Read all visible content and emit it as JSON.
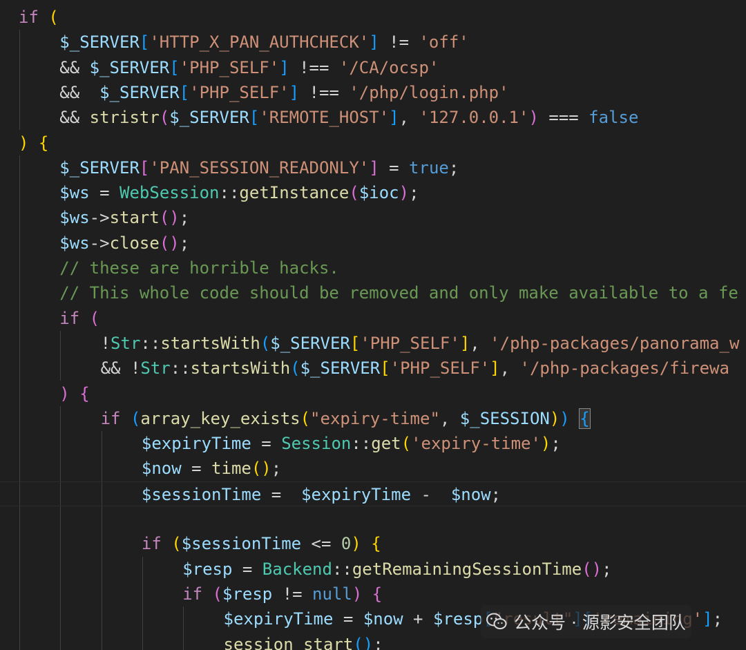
{
  "editor": {
    "colors": {
      "background": "#1f1f1f",
      "keyword": "#c586c0",
      "variable": "#9cdcfe",
      "string": "#ce9178",
      "function": "#dcdcaa",
      "class": "#4ec9b0",
      "comment": "#6a9955",
      "literal": "#569cd6",
      "number": "#b5cea8",
      "bracket_level1": "#ffd700",
      "bracket_level2": "#da70d6",
      "bracket_level3": "#179fff"
    },
    "current_line": 19,
    "lines": [
      {
        "indent": 0,
        "tokens": [
          {
            "t": "if ",
            "c": "kw"
          },
          {
            "t": "(",
            "c": "b1"
          }
        ]
      },
      {
        "indent": 1,
        "tokens": [
          {
            "t": "$_SERVER",
            "c": "var"
          },
          {
            "t": "[",
            "c": "b3"
          },
          {
            "t": "'HTTP_X_PAN_AUTHCHECK'",
            "c": "str"
          },
          {
            "t": "]",
            "c": "b3"
          },
          {
            "t": " != ",
            "c": "op"
          },
          {
            "t": "'off'",
            "c": "str"
          }
        ]
      },
      {
        "indent": 1,
        "tokens": [
          {
            "t": "&& ",
            "c": "op"
          },
          {
            "t": "$_SERVER",
            "c": "var"
          },
          {
            "t": "[",
            "c": "b3"
          },
          {
            "t": "'PHP_SELF'",
            "c": "str"
          },
          {
            "t": "]",
            "c": "b3"
          },
          {
            "t": " !== ",
            "c": "op"
          },
          {
            "t": "'/CA/ocsp'",
            "c": "str"
          }
        ]
      },
      {
        "indent": 1,
        "tokens": [
          {
            "t": "&&  ",
            "c": "op"
          },
          {
            "t": "$_SERVER",
            "c": "var"
          },
          {
            "t": "[",
            "c": "b3"
          },
          {
            "t": "'PHP_SELF'",
            "c": "str"
          },
          {
            "t": "]",
            "c": "b3"
          },
          {
            "t": " !== ",
            "c": "op"
          },
          {
            "t": "'/php/login.php'",
            "c": "str"
          }
        ]
      },
      {
        "indent": 1,
        "tokens": [
          {
            "t": "&& ",
            "c": "op"
          },
          {
            "t": "stristr",
            "c": "fn"
          },
          {
            "t": "(",
            "c": "b2"
          },
          {
            "t": "$_SERVER",
            "c": "var"
          },
          {
            "t": "[",
            "c": "b3"
          },
          {
            "t": "'REMOTE_HOST'",
            "c": "str"
          },
          {
            "t": "]",
            "c": "b3"
          },
          {
            "t": ", ",
            "c": "op"
          },
          {
            "t": "'127.0.0.1'",
            "c": "str"
          },
          {
            "t": ")",
            "c": "b2"
          },
          {
            "t": " === ",
            "c": "op"
          },
          {
            "t": "false",
            "c": "lit"
          }
        ]
      },
      {
        "indent": 0,
        "tokens": [
          {
            "t": ")",
            "c": "b1"
          },
          {
            "t": " ",
            "c": "op"
          },
          {
            "t": "{",
            "c": "b1"
          }
        ]
      },
      {
        "indent": 1,
        "tokens": [
          {
            "t": "$_SERVER",
            "c": "var"
          },
          {
            "t": "[",
            "c": "b2"
          },
          {
            "t": "'PAN_SESSION_READONLY'",
            "c": "str"
          },
          {
            "t": "]",
            "c": "b2"
          },
          {
            "t": " = ",
            "c": "op"
          },
          {
            "t": "true",
            "c": "lit"
          },
          {
            "t": ";",
            "c": "op"
          }
        ]
      },
      {
        "indent": 1,
        "tokens": [
          {
            "t": "$ws",
            "c": "var"
          },
          {
            "t": " = ",
            "c": "op"
          },
          {
            "t": "WebSession",
            "c": "cls"
          },
          {
            "t": "::",
            "c": "op"
          },
          {
            "t": "getInstance",
            "c": "fn"
          },
          {
            "t": "(",
            "c": "b2"
          },
          {
            "t": "$ioc",
            "c": "var"
          },
          {
            "t": ")",
            "c": "b2"
          },
          {
            "t": ";",
            "c": "op"
          }
        ]
      },
      {
        "indent": 1,
        "tokens": [
          {
            "t": "$ws",
            "c": "var"
          },
          {
            "t": "->",
            "c": "op"
          },
          {
            "t": "start",
            "c": "fn"
          },
          {
            "t": "()",
            "c": "b2"
          },
          {
            "t": ";",
            "c": "op"
          }
        ]
      },
      {
        "indent": 1,
        "tokens": [
          {
            "t": "$ws",
            "c": "var"
          },
          {
            "t": "->",
            "c": "op"
          },
          {
            "t": "close",
            "c": "fn"
          },
          {
            "t": "()",
            "c": "b2"
          },
          {
            "t": ";",
            "c": "op"
          }
        ]
      },
      {
        "indent": 1,
        "tokens": [
          {
            "t": "// these are horrible hacks.",
            "c": "cmt"
          }
        ]
      },
      {
        "indent": 1,
        "tokens": [
          {
            "t": "// This whole code should be removed and only make available to a fe",
            "c": "cmt"
          }
        ]
      },
      {
        "indent": 1,
        "tokens": [
          {
            "t": "if ",
            "c": "kw"
          },
          {
            "t": "(",
            "c": "b2"
          }
        ]
      },
      {
        "indent": 2,
        "tokens": [
          {
            "t": "!",
            "c": "op"
          },
          {
            "t": "Str",
            "c": "cls"
          },
          {
            "t": "::",
            "c": "op"
          },
          {
            "t": "startsWith",
            "c": "fn"
          },
          {
            "t": "(",
            "c": "b3"
          },
          {
            "t": "$_SERVER",
            "c": "var"
          },
          {
            "t": "[",
            "c": "b1"
          },
          {
            "t": "'PHP_SELF'",
            "c": "str"
          },
          {
            "t": "]",
            "c": "b1"
          },
          {
            "t": ", ",
            "c": "op"
          },
          {
            "t": "'/php-packages/panorama_w",
            "c": "str"
          }
        ]
      },
      {
        "indent": 2,
        "tokens": [
          {
            "t": "&& !",
            "c": "op"
          },
          {
            "t": "Str",
            "c": "cls"
          },
          {
            "t": "::",
            "c": "op"
          },
          {
            "t": "startsWith",
            "c": "fn"
          },
          {
            "t": "(",
            "c": "b3"
          },
          {
            "t": "$_SERVER",
            "c": "var"
          },
          {
            "t": "[",
            "c": "b1"
          },
          {
            "t": "'PHP_SELF'",
            "c": "str"
          },
          {
            "t": "]",
            "c": "b1"
          },
          {
            "t": ", ",
            "c": "op"
          },
          {
            "t": "'/php-packages/firewa",
            "c": "str"
          }
        ]
      },
      {
        "indent": 1,
        "tokens": [
          {
            "t": ")",
            "c": "b2"
          },
          {
            "t": " ",
            "c": "op"
          },
          {
            "t": "{",
            "c": "b2"
          }
        ]
      },
      {
        "indent": 2,
        "tokens": [
          {
            "t": "if ",
            "c": "kw"
          },
          {
            "t": "(",
            "c": "b3"
          },
          {
            "t": "array_key_exists",
            "c": "fn"
          },
          {
            "t": "(",
            "c": "b1"
          },
          {
            "t": "\"expiry-time\"",
            "c": "str"
          },
          {
            "t": ", ",
            "c": "op"
          },
          {
            "t": "$_SESSION",
            "c": "var"
          },
          {
            "t": ")",
            "c": "b1"
          },
          {
            "t": ")",
            "c": "b3"
          },
          {
            "t": " ",
            "c": "op"
          },
          {
            "t": "{",
            "c": "b3",
            "m": true
          }
        ]
      },
      {
        "indent": 3,
        "tokens": [
          {
            "t": "$expiryTime",
            "c": "var"
          },
          {
            "t": " = ",
            "c": "op"
          },
          {
            "t": "Session",
            "c": "cls"
          },
          {
            "t": "::",
            "c": "op"
          },
          {
            "t": "get",
            "c": "fn"
          },
          {
            "t": "(",
            "c": "b1"
          },
          {
            "t": "'expiry-time'",
            "c": "str"
          },
          {
            "t": ")",
            "c": "b1"
          },
          {
            "t": ";",
            "c": "op"
          }
        ]
      },
      {
        "indent": 3,
        "tokens": [
          {
            "t": "$now",
            "c": "var"
          },
          {
            "t": " = ",
            "c": "op"
          },
          {
            "t": "time",
            "c": "fn"
          },
          {
            "t": "()",
            "c": "b1"
          },
          {
            "t": ";",
            "c": "op"
          }
        ]
      },
      {
        "indent": 3,
        "tokens": [
          {
            "t": "$sessionTime",
            "c": "var"
          },
          {
            "t": " =  ",
            "c": "op"
          },
          {
            "t": "$expiryTime",
            "c": "var"
          },
          {
            "t": " -  ",
            "c": "op"
          },
          {
            "t": "$now",
            "c": "var"
          },
          {
            "t": ";",
            "c": "op"
          }
        ]
      },
      {
        "indent": 3,
        "tokens": []
      },
      {
        "indent": 3,
        "tokens": [
          {
            "t": "if ",
            "c": "kw"
          },
          {
            "t": "(",
            "c": "b1"
          },
          {
            "t": "$sessionTime",
            "c": "var"
          },
          {
            "t": " <= ",
            "c": "op"
          },
          {
            "t": "0",
            "c": "num"
          },
          {
            "t": ")",
            "c": "b1"
          },
          {
            "t": " ",
            "c": "op"
          },
          {
            "t": "{",
            "c": "b1"
          }
        ]
      },
      {
        "indent": 4,
        "tokens": [
          {
            "t": "$resp",
            "c": "var"
          },
          {
            "t": " = ",
            "c": "op"
          },
          {
            "t": "Backend",
            "c": "cls"
          },
          {
            "t": "::",
            "c": "op"
          },
          {
            "t": "getRemainingSessionTime",
            "c": "fn"
          },
          {
            "t": "()",
            "c": "b2"
          },
          {
            "t": ";",
            "c": "op"
          }
        ]
      },
      {
        "indent": 4,
        "tokens": [
          {
            "t": "if ",
            "c": "kw"
          },
          {
            "t": "(",
            "c": "b2"
          },
          {
            "t": "$resp",
            "c": "var"
          },
          {
            "t": " != ",
            "c": "op"
          },
          {
            "t": "null",
            "c": "lit"
          },
          {
            "t": ")",
            "c": "b2"
          },
          {
            "t": " ",
            "c": "op"
          },
          {
            "t": "{",
            "c": "b2"
          }
        ]
      },
      {
        "indent": 5,
        "tokens": [
          {
            "t": "$expiryTime",
            "c": "var"
          },
          {
            "t": " = ",
            "c": "op"
          },
          {
            "t": "$now",
            "c": "var"
          },
          {
            "t": " + ",
            "c": "op"
          },
          {
            "t": "$resp",
            "c": "var"
          },
          {
            "t": "[",
            "c": "b3"
          },
          {
            "t": "\"result\"",
            "c": "str"
          },
          {
            "t": "]",
            "c": "b3"
          },
          {
            "t": "[",
            "c": "b3"
          },
          {
            "t": "'remaining'",
            "c": "str"
          },
          {
            "t": "]",
            "c": "b3"
          },
          {
            "t": ";",
            "c": "op"
          }
        ]
      },
      {
        "indent": 5,
        "tokens": [
          {
            "t": "session_start",
            "c": "fn"
          },
          {
            "t": "()",
            "c": "b3"
          },
          {
            "t": ";",
            "c": "op"
          }
        ]
      }
    ]
  },
  "watermark": {
    "icon": "wechat-icon",
    "text": "公众号 · 源影安全团队"
  }
}
